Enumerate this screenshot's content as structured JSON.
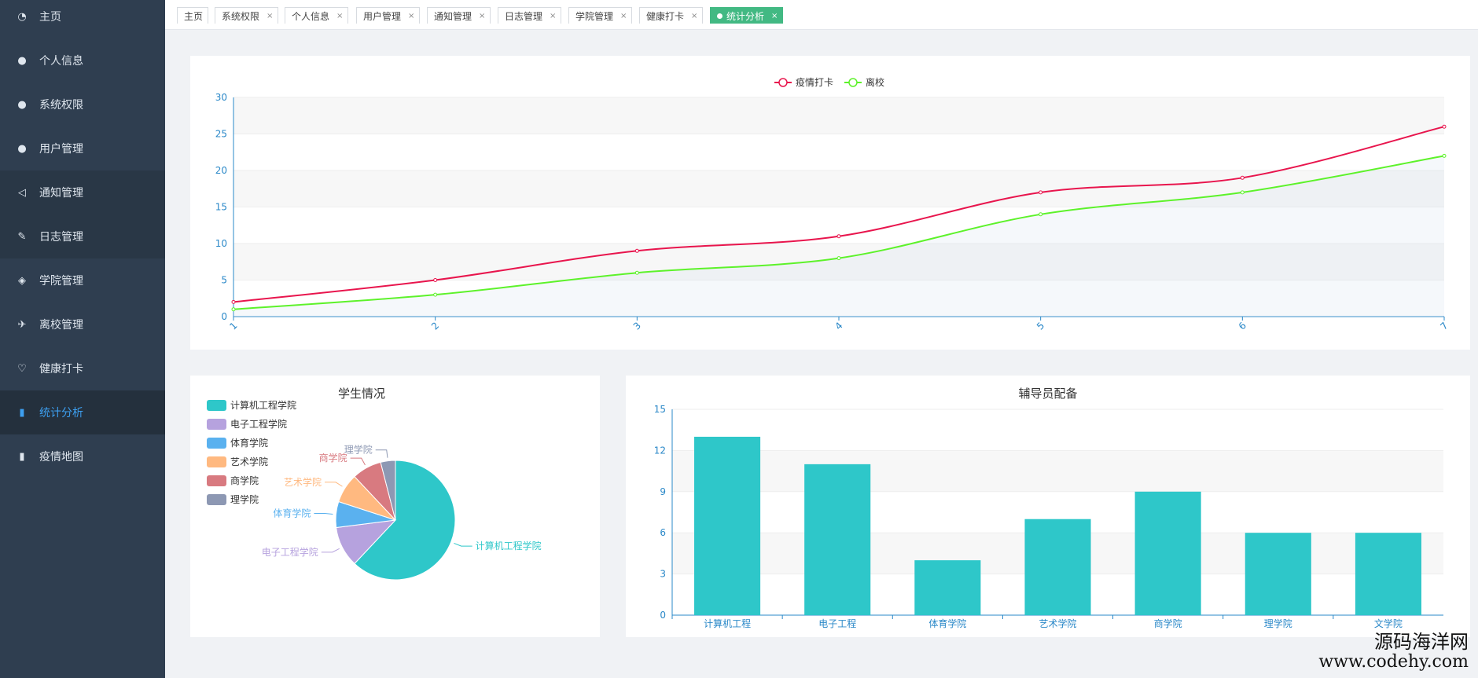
{
  "sidebar": {
    "items": [
      {
        "label": "主页",
        "icon": "dashboard-icon",
        "glyph": "◔"
      },
      {
        "label": "个人信息",
        "icon": "user-icon",
        "glyph": "●"
      },
      {
        "label": "系统权限",
        "icon": "user-key-icon",
        "glyph": "●"
      },
      {
        "label": "用户管理",
        "icon": "users-icon",
        "glyph": "●"
      },
      {
        "label": "通知管理",
        "icon": "volume-icon",
        "glyph": "◁"
      },
      {
        "label": "日志管理",
        "icon": "feather-icon",
        "glyph": "✎"
      },
      {
        "label": "学院管理",
        "icon": "diamond-icon",
        "glyph": "◈"
      },
      {
        "label": "离校管理",
        "icon": "running-icon",
        "glyph": "✈"
      },
      {
        "label": "健康打卡",
        "icon": "heart-icon",
        "glyph": "♡"
      },
      {
        "label": "统计分析",
        "icon": "bar-chart-icon",
        "glyph": "▮"
      },
      {
        "label": "疫情地图",
        "icon": "bar-chart-icon",
        "glyph": "▮"
      }
    ],
    "active_index": 9
  },
  "tabs": [
    {
      "label": "主页",
      "closable": false
    },
    {
      "label": "系统权限",
      "closable": true
    },
    {
      "label": "个人信息",
      "closable": true
    },
    {
      "label": "用户管理",
      "closable": true
    },
    {
      "label": "通知管理",
      "closable": true
    },
    {
      "label": "日志管理",
      "closable": true
    },
    {
      "label": "学院管理",
      "closable": true
    },
    {
      "label": "健康打卡",
      "closable": true
    },
    {
      "label": "统计分析",
      "closable": true,
      "active": true
    }
  ],
  "close_glyph": "×",
  "colors": {
    "sidebar_bg": "#2f3e50",
    "active_tab": "#42b983",
    "series_red": "#e8154d",
    "series_green": "#5df22a",
    "teal": "#2ec7c9",
    "axis": "#2a88c8"
  },
  "chart_data": [
    {
      "type": "line",
      "smooth": true,
      "x": [
        "1",
        "2",
        "3",
        "4",
        "5",
        "6",
        "7"
      ],
      "series": [
        {
          "name": "疫情打卡",
          "values": [
            2,
            5,
            9,
            11,
            17,
            19,
            26
          ],
          "color": "#e8154d"
        },
        {
          "name": "离校",
          "values": [
            1,
            3,
            6,
            8,
            14,
            17,
            22
          ],
          "color": "#5df22a"
        }
      ],
      "ylim": [
        0,
        30
      ],
      "yticks": [
        0,
        5,
        10,
        15,
        20,
        25,
        30
      ],
      "legend": "top-center",
      "grid": true
    },
    {
      "type": "pie",
      "title": "学生情况",
      "legend": "top-left",
      "slices": [
        {
          "label": "计算机工程学院",
          "value": 62,
          "color": "#2ec7c9"
        },
        {
          "label": "电子工程学院",
          "value": 11,
          "color": "#b6a2de"
        },
        {
          "label": "体育学院",
          "value": 7,
          "color": "#5ab1ef"
        },
        {
          "label": "艺术学院",
          "value": 8,
          "color": "#ffb980"
        },
        {
          "label": "商学院",
          "value": 8,
          "color": "#d87a80"
        },
        {
          "label": "理学院",
          "value": 4,
          "color": "#8d98b3"
        }
      ]
    },
    {
      "type": "bar",
      "title": "辅导员配备",
      "categories": [
        "计算机工程",
        "电子工程",
        "体育学院",
        "艺术学院",
        "商学院",
        "理学院",
        "文学院"
      ],
      "values": [
        13,
        11,
        4,
        7,
        9,
        6,
        6
      ],
      "ylim": [
        0,
        15
      ],
      "yticks": [
        0,
        3,
        6,
        9,
        12,
        15
      ],
      "color": "#2ec7c9",
      "grid": true
    }
  ],
  "watermark": {
    "line1": "源码海洋网",
    "line2": "www.codehy.com"
  }
}
